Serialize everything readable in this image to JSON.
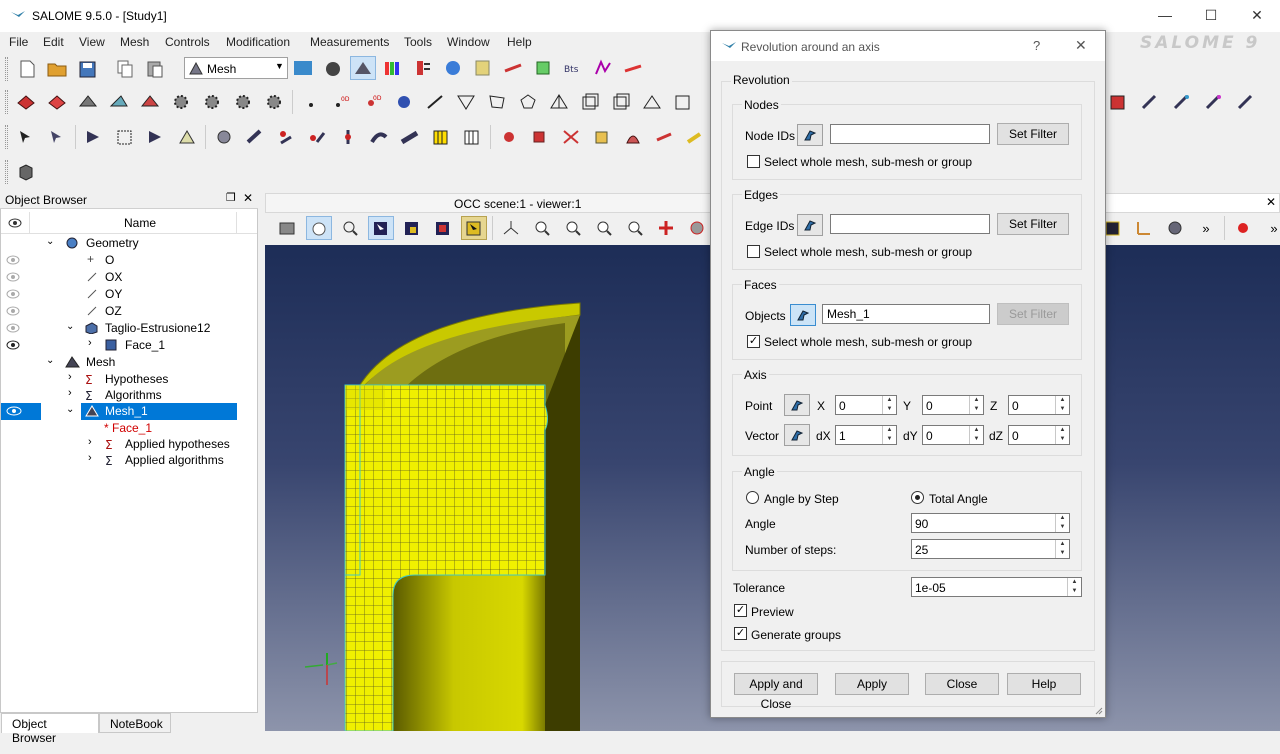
{
  "window": {
    "title": "SALOME  9.5.0 - [Study1]",
    "brand": "SALOME 9"
  },
  "menu": [
    "File",
    "Edit",
    "View",
    "Mesh",
    "Controls",
    "Modification",
    "Measurements",
    "Tools",
    "Window",
    "Help"
  ],
  "module_select": {
    "value": "Mesh"
  },
  "object_browser": {
    "title": "Object Browser",
    "column_name": "Name",
    "tree": [
      {
        "label": "Geometry",
        "level": 0
      },
      {
        "label": "O",
        "level": 1
      },
      {
        "label": "OX",
        "level": 1
      },
      {
        "label": "OY",
        "level": 1
      },
      {
        "label": "OZ",
        "level": 1
      },
      {
        "label": "Taglio-Estrusione12",
        "level": 1
      },
      {
        "label": "Face_1",
        "level": 2
      },
      {
        "label": "Mesh",
        "level": 0
      },
      {
        "label": "Hypotheses",
        "level": 1
      },
      {
        "label": "Algorithms",
        "level": 1
      },
      {
        "label": "Mesh_1",
        "level": 1
      },
      {
        "label": "* Face_1",
        "level": 2
      },
      {
        "label": "Applied hypotheses",
        "level": 2
      },
      {
        "label": "Applied algorithms",
        "level": 2
      }
    ]
  },
  "bottom_tabs": [
    "Object Browser",
    "NoteBook"
  ],
  "viewer": {
    "title": "OCC scene:1 - viewer:1"
  },
  "dialog": {
    "title": "Revolution around an axis",
    "help_glyph": "?",
    "close_glyph": "✕",
    "revolution_label": "Revolution",
    "nodes": {
      "title": "Nodes",
      "ids_label": "Node IDs",
      "ids_value": "",
      "filter": "Set Filter",
      "whole_mesh": "Select whole mesh, sub-mesh or group",
      "whole_checked": false
    },
    "edges": {
      "title": "Edges",
      "ids_label": "Edge IDs",
      "ids_value": "",
      "filter": "Set Filter",
      "whole_mesh": "Select whole mesh, sub-mesh or group",
      "whole_checked": false
    },
    "faces": {
      "title": "Faces",
      "ids_label": "Objects",
      "ids_value": "Mesh_1",
      "filter": "Set Filter",
      "whole_mesh": "Select whole mesh, sub-mesh or group",
      "whole_checked": true
    },
    "axis": {
      "title": "Axis",
      "point_label": "Point",
      "vector_label": "Vector",
      "x_label": "X",
      "y_label": "Y",
      "z_label": "Z",
      "dx_label": "dX",
      "dy_label": "dY",
      "dz_label": "dZ",
      "point": {
        "x": "0",
        "y": "0",
        "z": "0"
      },
      "vector": {
        "dx": "1",
        "dy": "0",
        "dz": "0"
      }
    },
    "angle": {
      "title": "Angle",
      "by_step": "Angle by Step",
      "total": "Total Angle",
      "angle_label": "Angle",
      "angle_value": "90",
      "steps_label": "Number of steps:",
      "steps_value": "25",
      "selected": "total"
    },
    "tolerance": {
      "label": "Tolerance",
      "value": "1e-05"
    },
    "preview": {
      "label": "Preview",
      "checked": true
    },
    "generate_groups": {
      "label": "Generate groups",
      "checked": true
    },
    "buttons": {
      "apply_close": "Apply and Close",
      "apply": "Apply",
      "close": "Close",
      "help": "Help"
    }
  }
}
